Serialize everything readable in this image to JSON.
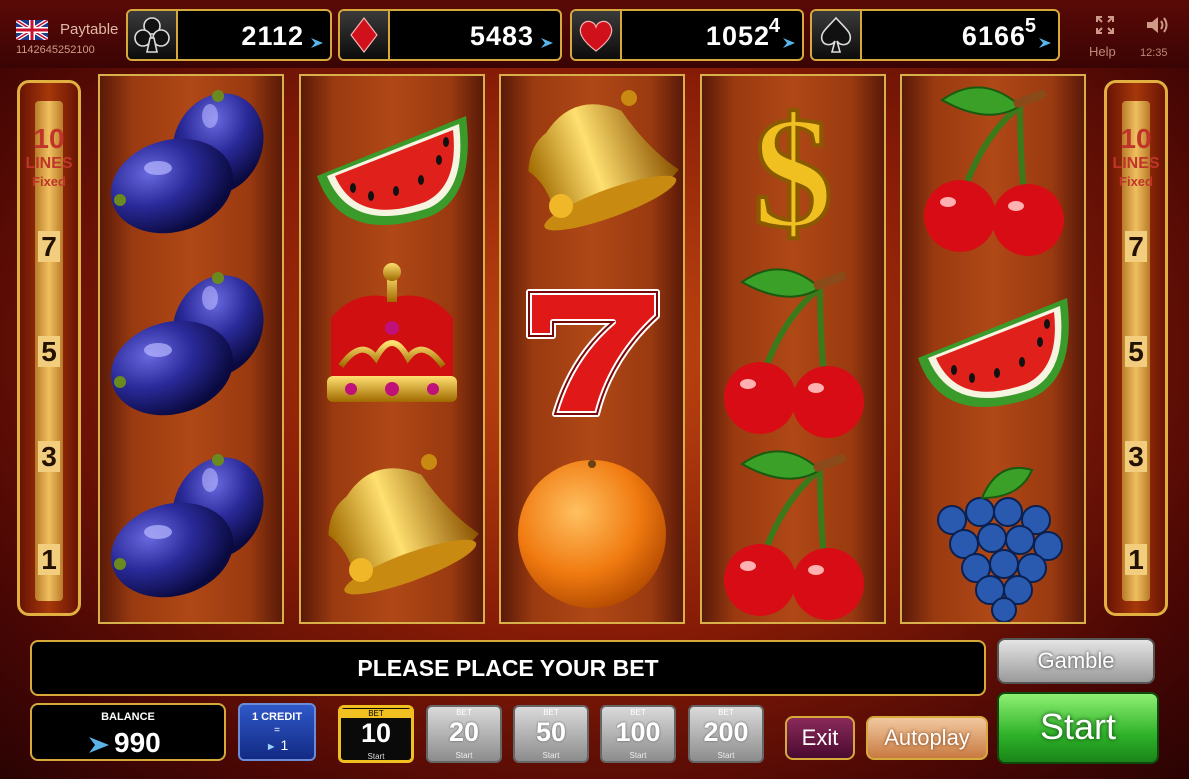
{
  "header": {
    "paytable_label": "Paytable",
    "ticket_id": "1142645252100",
    "help_label": "Help",
    "time": "12:35"
  },
  "jackpots": [
    {
      "suit": "club",
      "value": "2112",
      "superscript": ""
    },
    {
      "suit": "diamond",
      "value": "5483",
      "superscript": ""
    },
    {
      "suit": "heart",
      "value": "1052",
      "superscript": "4"
    },
    {
      "suit": "spade",
      "value": "6166",
      "superscript": "5"
    }
  ],
  "lines_panel": {
    "count": "10",
    "lines_label": "LINES",
    "mode": "Fixed",
    "markers": [
      "7",
      "5",
      "3",
      "1"
    ]
  },
  "reels": [
    [
      "plum",
      "plum",
      "plum"
    ],
    [
      "watermelon",
      "crown",
      "bell"
    ],
    [
      "bell",
      "seven",
      "orange"
    ],
    [
      "dollar",
      "cherry",
      "cherry"
    ],
    [
      "cherry",
      "watermelon",
      "grapes"
    ]
  ],
  "message": "PLEASE PLACE YOUR BET",
  "buttons": {
    "gamble": "Gamble",
    "start": "Start",
    "exit": "Exit",
    "autoplay": "Autoplay"
  },
  "balance": {
    "label": "BALANCE",
    "value": "990"
  },
  "credit": {
    "label": "1 CREDIT",
    "equals": "=",
    "value": "1"
  },
  "bets": [
    {
      "tag": "BET",
      "value": "10",
      "sub": "Start",
      "selected": true
    },
    {
      "tag": "BET",
      "value": "20",
      "sub": "Start",
      "selected": false
    },
    {
      "tag": "BET",
      "value": "50",
      "sub": "Start",
      "selected": false
    },
    {
      "tag": "BET",
      "value": "100",
      "sub": "Start",
      "selected": false
    },
    {
      "tag": "BET",
      "value": "200",
      "sub": "Start",
      "selected": false
    }
  ],
  "colors": {
    "gold_frame": "#d7a93a",
    "start_green": "#2fb22a",
    "background_red": "#8a1d07"
  }
}
